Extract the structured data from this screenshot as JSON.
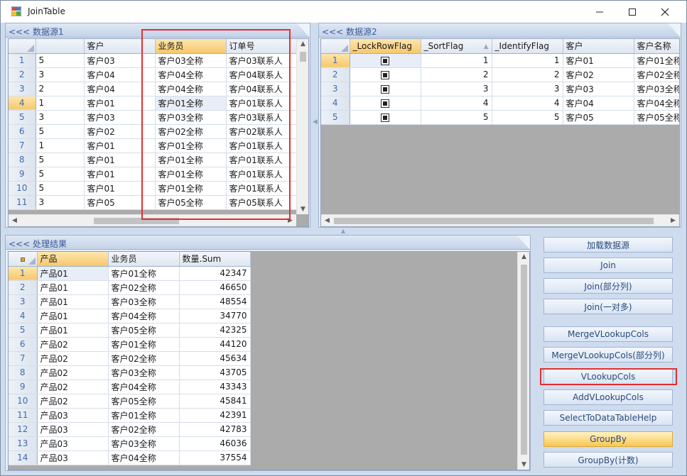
{
  "window": {
    "title": "JoinTable"
  },
  "source1": {
    "title": "<<< 数据源1",
    "columns": [
      "",
      "客户",
      "业务员",
      "订单号"
    ],
    "rows": [
      {
        "n": "1",
        "c0": "5",
        "c1": "客户03",
        "c2": "客户03全称",
        "c3": "客户03联系人"
      },
      {
        "n": "2",
        "c0": "3",
        "c1": "客户04",
        "c2": "客户04全称",
        "c3": "客户04联系人"
      },
      {
        "n": "3",
        "c0": "2",
        "c1": "客户04",
        "c2": "客户04全称",
        "c3": "客户04联系人"
      },
      {
        "n": "4",
        "c0": "1",
        "c1": "客户01",
        "c2": "客户01全称",
        "c3": "客户01联系人"
      },
      {
        "n": "5",
        "c0": "3",
        "c1": "客户03",
        "c2": "客户03全称",
        "c3": "客户03联系人"
      },
      {
        "n": "6",
        "c0": "5",
        "c1": "客户02",
        "c2": "客户02全称",
        "c3": "客户02联系人"
      },
      {
        "n": "7",
        "c0": "1",
        "c1": "客户01",
        "c2": "客户01全称",
        "c3": "客户01联系人"
      },
      {
        "n": "8",
        "c0": "5",
        "c1": "客户01",
        "c2": "客户01全称",
        "c3": "客户01联系人"
      },
      {
        "n": "9",
        "c0": "5",
        "c1": "客户01",
        "c2": "客户01全称",
        "c3": "客户01联系人"
      },
      {
        "n": "10",
        "c0": "5",
        "c1": "客户01",
        "c2": "客户01全称",
        "c3": "客户01联系人"
      },
      {
        "n": "11",
        "c0": "3",
        "c1": "客户05",
        "c2": "客户05全称",
        "c3": "客户05联系人"
      }
    ]
  },
  "source2": {
    "title": "<<< 数据源2",
    "columns": [
      "_LockRowFlag",
      "_SortFlag",
      "_IdentifyFlag",
      "客户",
      "客户名称"
    ],
    "rows": [
      {
        "n": "1",
        "sort": "1",
        "ident": "1",
        "cust": "客户01",
        "name": "客户01全称"
      },
      {
        "n": "2",
        "sort": "2",
        "ident": "2",
        "cust": "客户02",
        "name": "客户02全称"
      },
      {
        "n": "3",
        "sort": "3",
        "ident": "3",
        "cust": "客户03",
        "name": "客户03全称"
      },
      {
        "n": "4",
        "sort": "4",
        "ident": "4",
        "cust": "客户04",
        "name": "客户04全称"
      },
      {
        "n": "5",
        "sort": "5",
        "ident": "5",
        "cust": "客户05",
        "name": "客户05全称"
      }
    ]
  },
  "result": {
    "title": "<<< 处理结果",
    "columns": [
      "产品",
      "业务员",
      "数量.Sum"
    ],
    "rows": [
      {
        "n": "1",
        "p": "产品01",
        "s": "客户01全称",
        "q": "42347"
      },
      {
        "n": "2",
        "p": "产品01",
        "s": "客户02全称",
        "q": "46650"
      },
      {
        "n": "3",
        "p": "产品01",
        "s": "客户03全称",
        "q": "48554"
      },
      {
        "n": "4",
        "p": "产品01",
        "s": "客户04全称",
        "q": "34770"
      },
      {
        "n": "5",
        "p": "产品01",
        "s": "客户05全称",
        "q": "42325"
      },
      {
        "n": "6",
        "p": "产品02",
        "s": "客户01全称",
        "q": "44120"
      },
      {
        "n": "7",
        "p": "产品02",
        "s": "客户02全称",
        "q": "45634"
      },
      {
        "n": "8",
        "p": "产品02",
        "s": "客户03全称",
        "q": "43705"
      },
      {
        "n": "9",
        "p": "产品02",
        "s": "客户04全称",
        "q": "43343"
      },
      {
        "n": "10",
        "p": "产品02",
        "s": "客户05全称",
        "q": "45841"
      },
      {
        "n": "11",
        "p": "产品03",
        "s": "客户01全称",
        "q": "42391"
      },
      {
        "n": "12",
        "p": "产品03",
        "s": "客户02全称",
        "q": "42783"
      },
      {
        "n": "13",
        "p": "产品03",
        "s": "客户03全称",
        "q": "46036"
      },
      {
        "n": "14",
        "p": "产品03",
        "s": "客户04全称",
        "q": "37554"
      }
    ]
  },
  "buttons": [
    {
      "label": "加载数据源",
      "active": false,
      "boxed": false
    },
    {
      "label": "Join",
      "active": false,
      "boxed": false
    },
    {
      "label": "Join(部分列)",
      "active": false,
      "boxed": false
    },
    {
      "label": "Join(一对多)",
      "active": false,
      "boxed": false
    },
    {
      "label": "MergeVLookupCols",
      "active": false,
      "boxed": false
    },
    {
      "label": "MergeVLookupCols(部分列)",
      "active": false,
      "boxed": false
    },
    {
      "label": "VLookupCols",
      "active": false,
      "boxed": true
    },
    {
      "label": "AddVLookupCols",
      "active": false,
      "boxed": false
    },
    {
      "label": "SelectToDataTableHelp",
      "active": false,
      "boxed": false
    },
    {
      "label": "GroupBy",
      "active": true,
      "boxed": false
    },
    {
      "label": "GroupBy(计数)",
      "active": false,
      "boxed": false
    }
  ],
  "colors": {
    "highlight_box": "#e03030",
    "accent": "#f7c76b",
    "panel_header_text": "#3b5998"
  }
}
